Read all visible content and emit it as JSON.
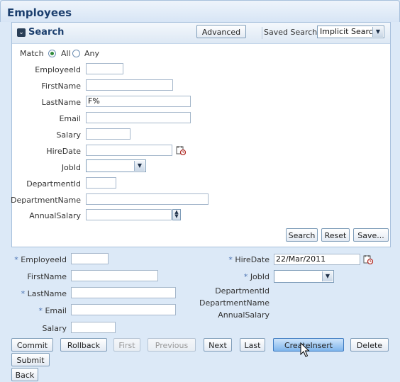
{
  "page": {
    "title": "Employees"
  },
  "search": {
    "title": "Search",
    "advanced_label": "Advanced",
    "saved_search_label": "Saved Search",
    "saved_search_value": "Implicit Search",
    "match_label": "Match",
    "match_all": "All",
    "match_any": "Any",
    "fields": [
      {
        "label": "EmployeeId",
        "value": ""
      },
      {
        "label": "FirstName",
        "value": ""
      },
      {
        "label": "LastName",
        "value": "F%"
      },
      {
        "label": "Email",
        "value": ""
      },
      {
        "label": "Salary",
        "value": ""
      },
      {
        "label": "HireDate",
        "value": ""
      },
      {
        "label": "JobId",
        "value": ""
      },
      {
        "label": "DepartmentId",
        "value": ""
      },
      {
        "label": "DepartmentName",
        "value": ""
      },
      {
        "label": "AnnualSalary",
        "value": ""
      }
    ],
    "search_button": "Search",
    "reset_button": "Reset",
    "save_button": "Save..."
  },
  "form": {
    "required_mark": "*",
    "employee_id": {
      "label": "EmployeeId",
      "value": ""
    },
    "first_name": {
      "label": "FirstName",
      "value": ""
    },
    "last_name": {
      "label": "LastName",
      "value": ""
    },
    "email": {
      "label": "Email",
      "value": ""
    },
    "salary": {
      "label": "Salary",
      "value": ""
    },
    "hire_date": {
      "label": "HireDate",
      "value": "22/Mar/2011"
    },
    "job_id": {
      "label": "JobId",
      "value": ""
    },
    "department_id": {
      "label": "DepartmentId"
    },
    "department_name": {
      "label": "DepartmentName"
    },
    "annual_salary": {
      "label": "AnnualSalary"
    }
  },
  "buttons": {
    "commit": "Commit",
    "rollback": "Rollback",
    "first": "First",
    "previous": "Previous",
    "next": "Next",
    "last": "Last",
    "create_insert": "CreateInsert",
    "delete": "Delete",
    "submit": "Submit",
    "back": "Back"
  }
}
